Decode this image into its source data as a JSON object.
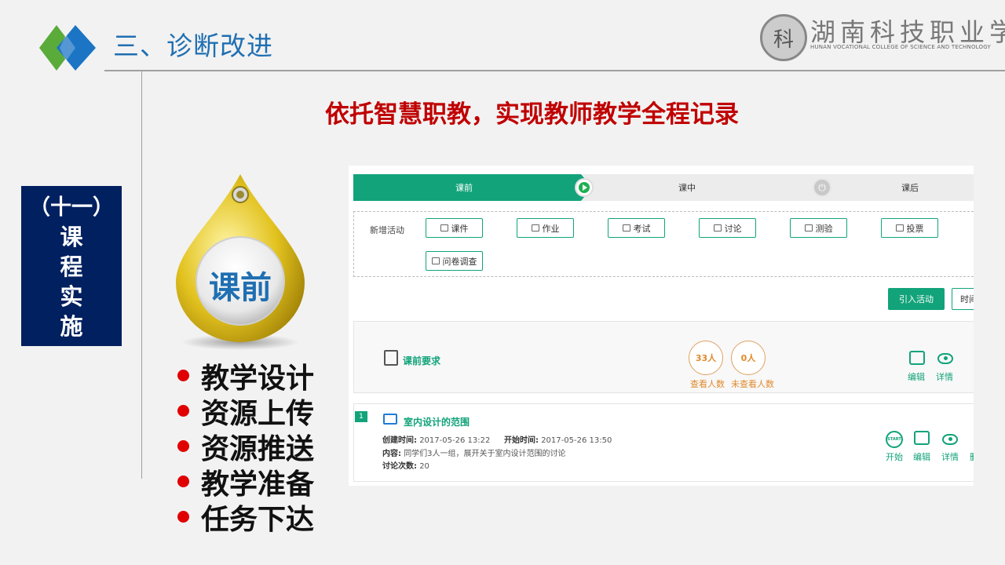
{
  "header": {
    "title": "三、诊断改进",
    "college_seal_char": "科",
    "college_name_cn": "湖南科技职业学院",
    "college_name_en": "HUNAN VOCATIONAL COLLEGE OF SCIENCE AND TECHNOLOGY"
  },
  "headline": "依托智慧职教，实现教师教学全程记录",
  "section": {
    "number": "（十一）",
    "chars": [
      "课",
      "程",
      "实",
      "施"
    ]
  },
  "badge": {
    "label": "课前"
  },
  "bullets": [
    "教学设计",
    "资源上传",
    "资源推送",
    "教学准备",
    "任务下达"
  ],
  "screenshot": {
    "steps": [
      "课前",
      "课中",
      "课后"
    ],
    "add_activity_label": "新增活动",
    "activity_buttons": [
      "课件",
      "作业",
      "考试",
      "讨论",
      "测验",
      "投票",
      "问卷调查"
    ],
    "import_button": "引入活动",
    "time_button": "时间",
    "requirement": {
      "title": "课前要求",
      "viewed_count": "33人",
      "viewed_label": "查看人数",
      "unviewed_count": "0人",
      "unviewed_label": "未查看人数",
      "edit_label": "编辑",
      "detail_label": "详情"
    },
    "item": {
      "index": "1",
      "title": "室内设计的范围",
      "created_label": "创建时间:",
      "created_value": "2017-05-26 13:22",
      "start_label": "开始时间:",
      "start_value": "2017-05-26 13:50",
      "content_label": "内容:",
      "content_value": "同学们3人一组，展开关于室内设计范围的讨论",
      "count_label": "讨论次数:",
      "count_value": "20",
      "start_icon_text": "START",
      "actions": [
        "开始",
        "编辑",
        "详情",
        "删"
      ]
    }
  },
  "colors": {
    "title_blue": "#1f6fb2",
    "headline_red": "#c00000",
    "section_navy": "#002060",
    "accent_green": "#12a37a",
    "bullet_red": "#e00000"
  }
}
